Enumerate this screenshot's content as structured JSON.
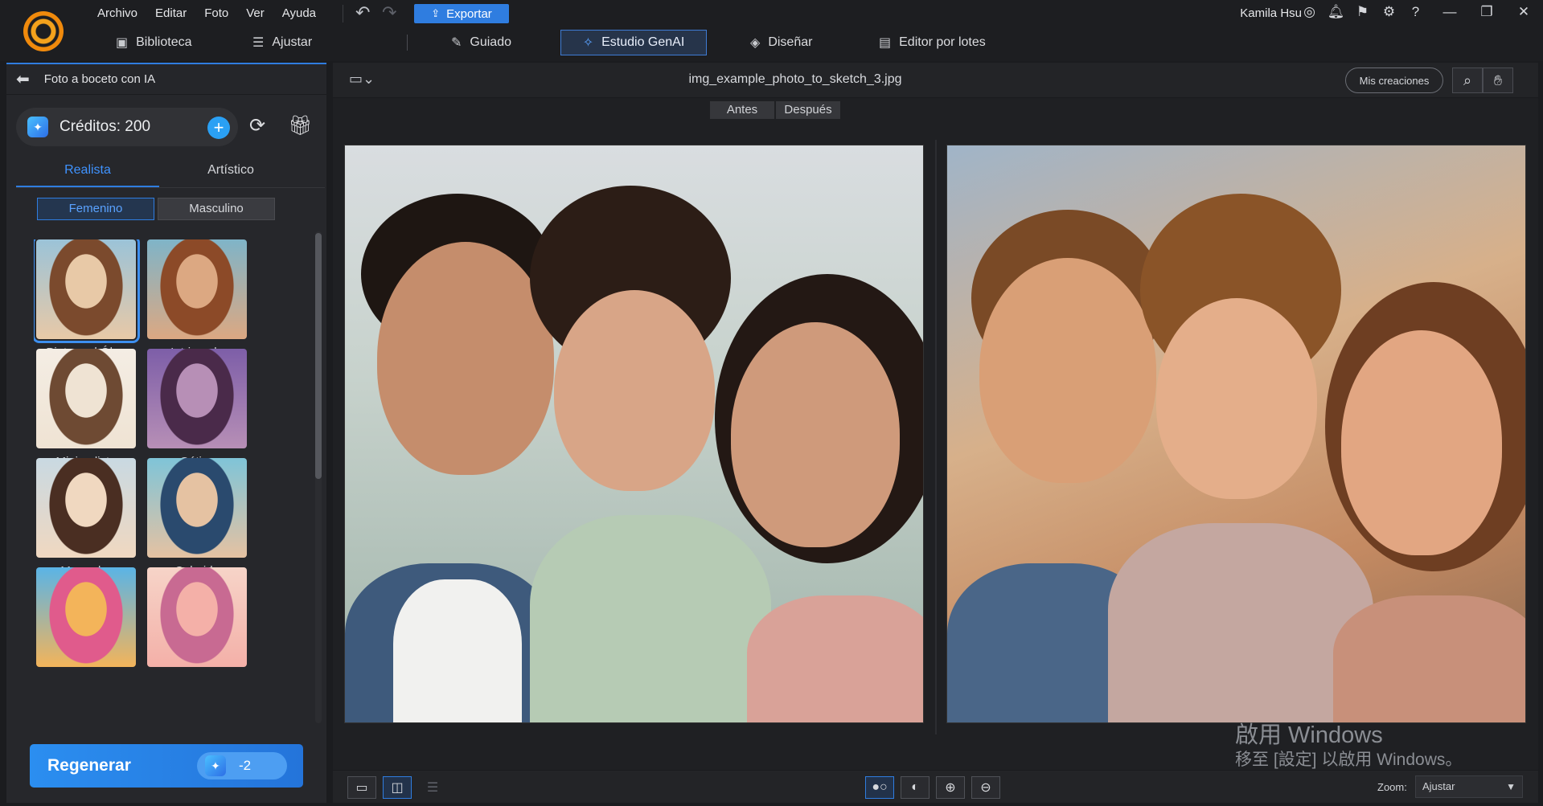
{
  "menu": [
    "Archivo",
    "Editar",
    "Foto",
    "Ver",
    "Ayuda"
  ],
  "toolbar": {
    "export_label": "Exportar"
  },
  "user": {
    "name": "Kamila Hsu"
  },
  "nav": [
    {
      "label": "Biblioteca",
      "icon": "library-icon"
    },
    {
      "label": "Ajustar",
      "icon": "sliders-icon"
    },
    {
      "label": "Guiado",
      "icon": "wand-icon"
    },
    {
      "label": "Estudio GenAI",
      "icon": "sparkle-icon",
      "active": true
    },
    {
      "label": "Diseñar",
      "icon": "layers-icon"
    },
    {
      "label": "Editor por lotes",
      "icon": "batch-icon"
    }
  ],
  "panel": {
    "title": "Foto a boceto con IA",
    "credits": "Créditos: 200",
    "tabs": [
      "Realista",
      "Artístico"
    ],
    "gender": [
      "Femenino",
      "Masculino"
    ],
    "styles": [
      {
        "label": "Pintura al Óleo",
        "selected": true,
        "colors": [
          "#e8c9a7",
          "#7b4a2d",
          "#9bc3d8"
        ]
      },
      {
        "label": "Intrincado",
        "colors": [
          "#dca882",
          "#8c4a28",
          "#7fb4c8"
        ]
      },
      {
        "label": "Minimalista",
        "colors": [
          "#efe3d3",
          "#6e4a33",
          "#f4ede4"
        ]
      },
      {
        "label": "Gótico",
        "colors": [
          "#b78fb6",
          "#4a2a4a",
          "#7d5ea8"
        ]
      },
      {
        "label": "Marcador",
        "colors": [
          "#f0d8c0",
          "#4a2e22",
          "#c9d9e2"
        ]
      },
      {
        "label": "Colorido",
        "colors": [
          "#e5c2a2",
          "#2a4a6e",
          "#7fc4d8"
        ]
      },
      {
        "label": "",
        "colors": [
          "#f3b45a",
          "#e05b8c",
          "#5ab4e6"
        ]
      },
      {
        "label": "",
        "colors": [
          "#f4b0a8",
          "#c86a92",
          "#f6d4c8"
        ]
      }
    ],
    "regen_label": "Regenerar",
    "regen_cost": "-2"
  },
  "viewer": {
    "filename": "img_example_photo_to_sketch_3.jpg",
    "my_creations": "Mis creaciones",
    "before": "Antes",
    "after": "Después",
    "zoom_label": "Zoom:",
    "zoom_value": "Ajustar"
  },
  "watermark": {
    "line1": "啟用 Windows",
    "line2": "移至 [設定] 以啟用 Windows。"
  }
}
